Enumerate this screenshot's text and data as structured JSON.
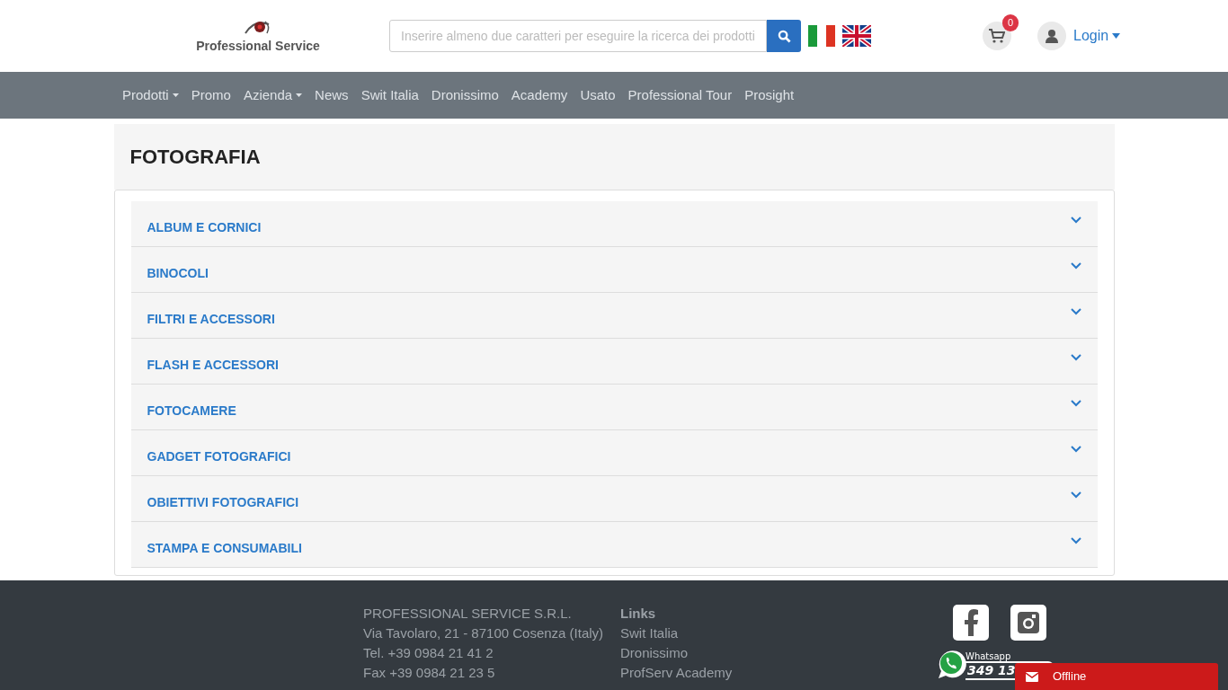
{
  "header": {
    "logo_text": "Professional Service",
    "search": {
      "placeholder": "Inserire almeno due caratteri per eseguire la ricerca dei prodotti"
    },
    "cart_count": "0",
    "login": "Login"
  },
  "nav": [
    {
      "label": "Prodotti",
      "dropdown": true
    },
    {
      "label": "Promo",
      "dropdown": false
    },
    {
      "label": "Azienda",
      "dropdown": true
    },
    {
      "label": "News",
      "dropdown": false
    },
    {
      "label": "Swit Italia",
      "dropdown": false
    },
    {
      "label": "Dronissimo",
      "dropdown": false
    },
    {
      "label": "Academy",
      "dropdown": false
    },
    {
      "label": "Usato",
      "dropdown": false
    },
    {
      "label": "Professional Tour",
      "dropdown": false
    },
    {
      "label": "Prosight",
      "dropdown": false
    }
  ],
  "category": {
    "title": "FOTOGRAFIA",
    "items": [
      {
        "label": "ALBUM E CORNICI",
        "expanded": false
      },
      {
        "label": "BINOCOLI",
        "expanded": false
      },
      {
        "label": "FILTRI E ACCESSORI",
        "expanded": false
      },
      {
        "label": "FLASH E ACCESSORI",
        "expanded": false
      },
      {
        "label": "FOTOCAMERE",
        "expanded": false
      },
      {
        "label": "GADGET FOTOGRAFICI",
        "expanded": false
      },
      {
        "label": "OBIETTIVI FOTOGRAFICI",
        "expanded": false
      },
      {
        "label": "STAMPA E CONSUMABILI",
        "expanded": false
      }
    ]
  },
  "footer": {
    "company": [
      "PROFESSIONAL SERVICE S.R.L.",
      "Via Tavolaro, 21 - 87100 Cosenza (Italy)",
      "Tel.  +39 0984 21 41 2",
      "Fax  +39 0984 21 23 5"
    ],
    "links_title": "Links",
    "links": [
      "Swit Italia",
      "Dronissimo",
      "ProfServ Academy"
    ],
    "whatsapp_label": "Whatsapp",
    "whatsapp_number": "349 13"
  },
  "chat": {
    "label": "Offline"
  }
}
